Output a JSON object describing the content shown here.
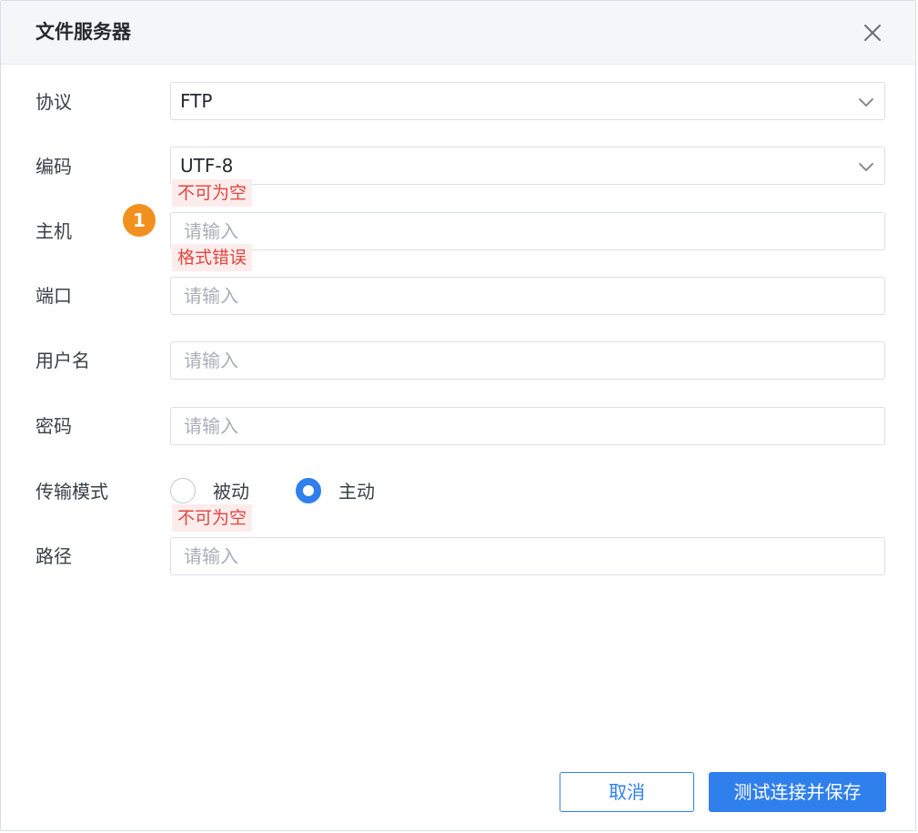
{
  "dialog": {
    "title": "文件服务器",
    "close_icon": "close-icon"
  },
  "form": {
    "protocol": {
      "label": "协议",
      "value": "FTP"
    },
    "encoding": {
      "label": "编码",
      "value": "UTF-8",
      "error": "不可为空"
    },
    "host": {
      "label": "主机",
      "placeholder": "请输入",
      "error": "格式错误",
      "badge": "1"
    },
    "port": {
      "label": "端口",
      "placeholder": "请输入"
    },
    "username": {
      "label": "用户名",
      "placeholder": "请输入"
    },
    "password": {
      "label": "密码",
      "placeholder": "请输入"
    },
    "transfer_mode": {
      "label": "传输模式",
      "options": [
        {
          "label": "被动",
          "selected": false
        },
        {
          "label": "主动",
          "selected": true
        }
      ],
      "error": "不可为空"
    },
    "path": {
      "label": "路径",
      "placeholder": "请输入"
    }
  },
  "footer": {
    "cancel_label": "取消",
    "save_label": "测试连接并保存"
  },
  "colors": {
    "primary": "#2f7fed",
    "error_text": "#e0473f",
    "error_bg": "#fdecec",
    "badge": "#f2901e"
  }
}
